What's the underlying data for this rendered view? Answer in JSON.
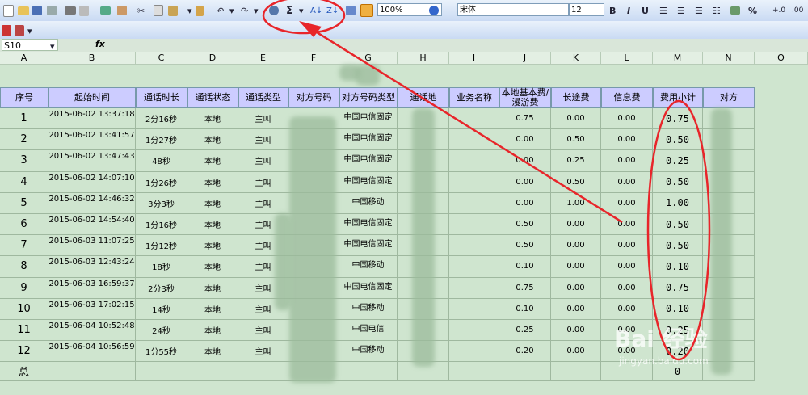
{
  "toolbar": {
    "zoom": "100%",
    "font": "宋体",
    "font_size": "12",
    "bold": "B",
    "italic": "I",
    "underline": "U",
    "percent": "%",
    "sum": "Σ"
  },
  "name_box": "S10",
  "fx": "fx",
  "columns": [
    "A",
    "B",
    "C",
    "D",
    "E",
    "F",
    "G",
    "H",
    "I",
    "J",
    "K",
    "L",
    "M",
    "N",
    "O"
  ],
  "headers": [
    "序号",
    "起始时间",
    "通话时长",
    "通话状态",
    "通话类型",
    "对方号码",
    "对方号码类型",
    "通话地",
    "业务名称",
    "本地基本费/\n漫游费",
    "长途费",
    "信息费",
    "费用小计",
    "对方"
  ],
  "rows": [
    {
      "n": "1",
      "t": "2015-06-02 13:37:18",
      "d": "2分16秒",
      "s": "本地",
      "c": "主叫",
      "nt": "中国电信固定",
      "f1": "0.75",
      "f2": "0.00",
      "f3": "0.00",
      "tot": "0.75"
    },
    {
      "n": "2",
      "t": "2015-06-02 13:41:57",
      "d": "1分27秒",
      "s": "本地",
      "c": "主叫",
      "nt": "中国电信固定",
      "f1": "0.00",
      "f2": "0.50",
      "f3": "0.00",
      "tot": "0.50"
    },
    {
      "n": "3",
      "t": "2015-06-02 13:47:43",
      "d": "48秒",
      "s": "本地",
      "c": "主叫",
      "nt": "中国电信固定",
      "f1": "0.00",
      "f2": "0.25",
      "f3": "0.00",
      "tot": "0.25"
    },
    {
      "n": "4",
      "t": "2015-06-02 14:07:10",
      "d": "1分26秒",
      "s": "本地",
      "c": "主叫",
      "nt": "中国电信固定",
      "f1": "0.00",
      "f2": "0.50",
      "f3": "0.00",
      "tot": "0.50"
    },
    {
      "n": "5",
      "t": "2015-06-02 14:46:32",
      "d": "3分3秒",
      "s": "本地",
      "c": "主叫",
      "nt": "中国移动",
      "f1": "0.00",
      "f2": "1.00",
      "f3": "0.00",
      "tot": "1.00"
    },
    {
      "n": "6",
      "t": "2015-06-02 14:54:40",
      "d": "1分16秒",
      "s": "本地",
      "c": "主叫",
      "nt": "中国电信固定",
      "f1": "0.50",
      "f2": "0.00",
      "f3": "0.00",
      "tot": "0.50"
    },
    {
      "n": "7",
      "t": "2015-06-03 11:07:25",
      "d": "1分12秒",
      "s": "本地",
      "c": "主叫",
      "nt": "中国电信固定",
      "f1": "0.50",
      "f2": "0.00",
      "f3": "0.00",
      "tot": "0.50"
    },
    {
      "n": "8",
      "t": "2015-06-03 12:43:24",
      "d": "18秒",
      "s": "本地",
      "c": "主叫",
      "nt": "中国移动",
      "f1": "0.10",
      "f2": "0.00",
      "f3": "0.00",
      "tot": "0.10"
    },
    {
      "n": "9",
      "t": "2015-06-03 16:59:37",
      "d": "2分3秒",
      "s": "本地",
      "c": "主叫",
      "nt": "中国电信固定",
      "f1": "0.75",
      "f2": "0.00",
      "f3": "0.00",
      "tot": "0.75"
    },
    {
      "n": "10",
      "t": "2015-06-03 17:02:15",
      "d": "14秒",
      "s": "本地",
      "c": "主叫",
      "nt": "中国移动",
      "f1": "0.10",
      "f2": "0.00",
      "f3": "0.00",
      "tot": "0.10"
    },
    {
      "n": "11",
      "t": "2015-06-04 10:52:48",
      "d": "24秒",
      "s": "本地",
      "c": "主叫",
      "nt": "中国电信",
      "f1": "0.25",
      "f2": "0.00",
      "f3": "0.00",
      "tot": "0.25"
    },
    {
      "n": "12",
      "t": "2015-06-04 10:56:59",
      "d": "1分55秒",
      "s": "本地",
      "c": "主叫",
      "nt": "中国移动",
      "f1": "0.20",
      "f2": "0.00",
      "f3": "0.00",
      "tot": "0.20"
    }
  ],
  "total_label": "总",
  "total_value": "0",
  "watermark": "Bai 经验",
  "watermark_url": "jingyan.baidu.com",
  "annotation_color": "#e8252a"
}
